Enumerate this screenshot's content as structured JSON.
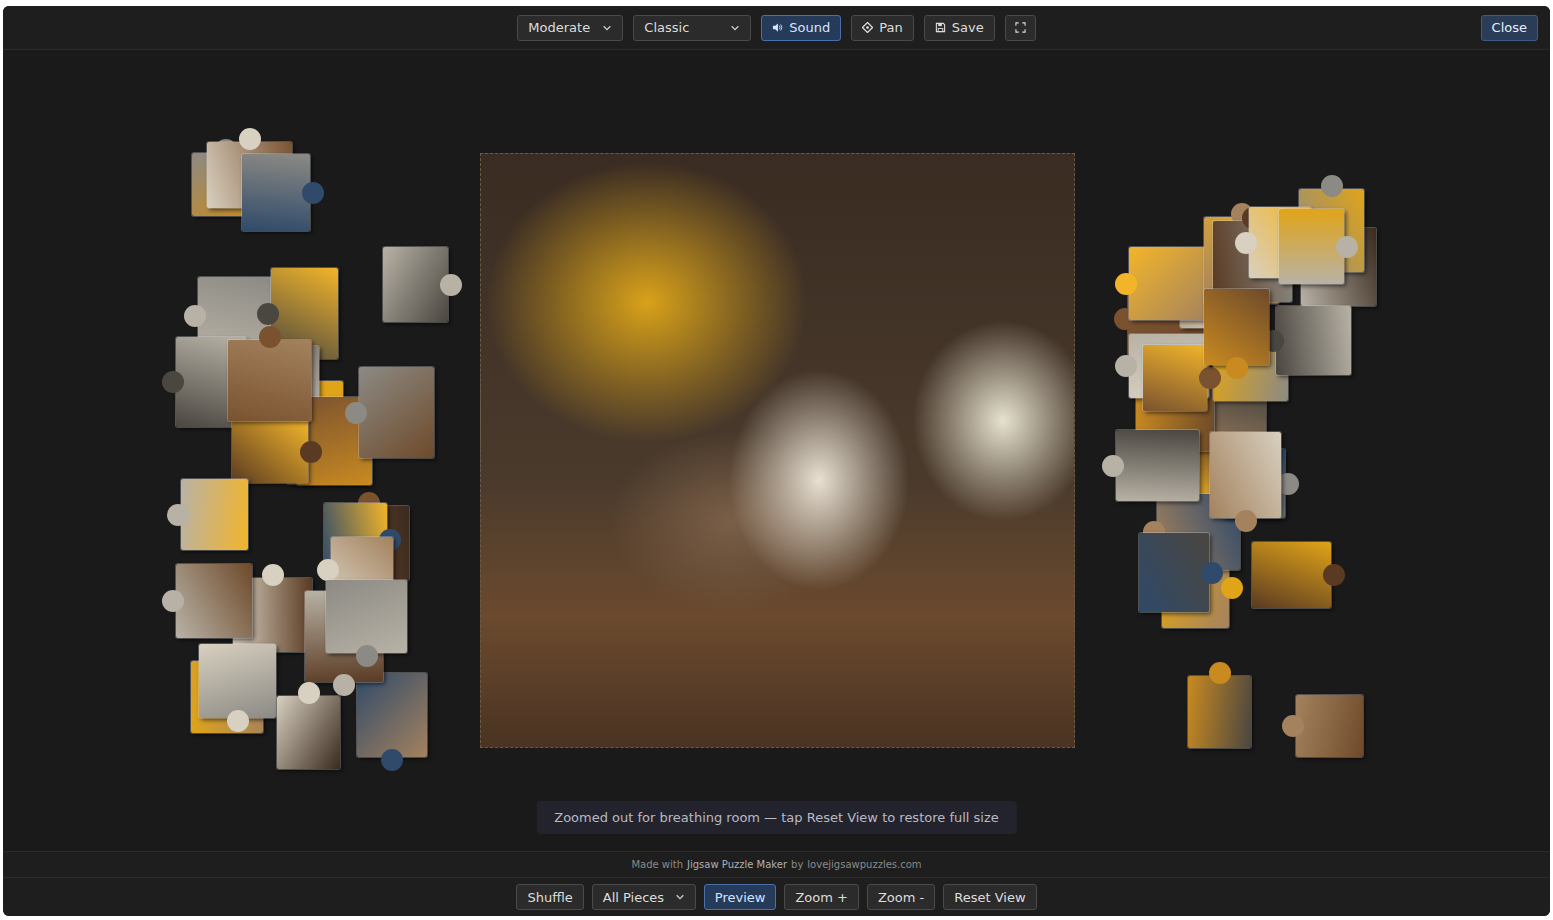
{
  "toolbar": {
    "difficulty": {
      "value": "Moderate"
    },
    "style": {
      "value": "Classic"
    },
    "buttons": [
      {
        "label": "Sound",
        "selected": true
      },
      {
        "label": "Pan",
        "selected": false
      },
      {
        "label": "Save",
        "selected": false
      }
    ],
    "close": "Close"
  },
  "toast": "Zoomed out for breathing room — tap Reset View to restore full size",
  "credit": [
    "Made with",
    "Jigsaw Puzzle Maker",
    "by",
    "lovejigsawpuzzles.com"
  ],
  "bottom_bar": {
    "shuffle": "Shuffle",
    "filter": {
      "value": "All Pieces"
    },
    "preview": {
      "label": "Preview",
      "selected": true
    },
    "buttons": [
      "Zoom +",
      "Zoom -",
      "Reset View"
    ]
  }
}
